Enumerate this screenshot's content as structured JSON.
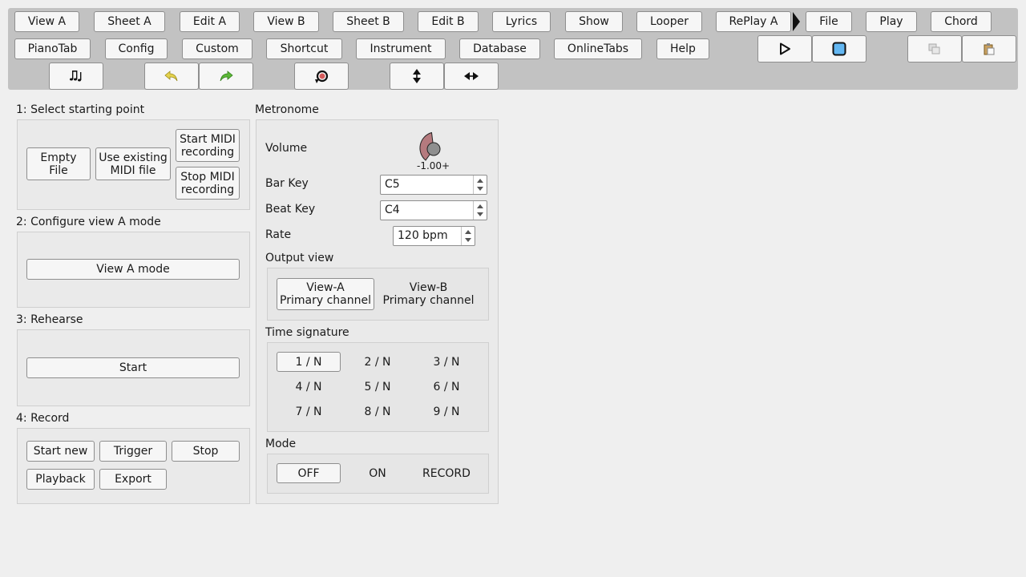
{
  "toolbar": {
    "row1": [
      "View A",
      "Sheet A",
      "Edit A",
      "View B",
      "Sheet B",
      "Edit B",
      "Lyrics",
      "Show",
      "Looper",
      "RePlay A",
      "File",
      "Play",
      "Chord"
    ],
    "row2": [
      "PianoTab",
      "Config",
      "Custom",
      "Shortcut",
      "Instrument",
      "Database",
      "OnlineTabs",
      "Help"
    ],
    "icons": {
      "play": "play-icon",
      "stop": "stop-icon",
      "copy": "copy-icon",
      "paste": "paste-icon",
      "notes": "music-notes-icon",
      "undo": "undo-icon",
      "redo": "redo-icon",
      "refresh": "refresh-icon",
      "vertical": "vertical-resize-icon",
      "horizontal": "horizontal-resize-icon"
    }
  },
  "step1": {
    "title": "1: Select starting point",
    "empty_file": "Empty\nFile",
    "use_existing": "Use existing\nMIDI file",
    "start_midi": "Start MIDI\nrecording",
    "stop_midi": "Stop MIDI\nrecording"
  },
  "step2": {
    "title": "2: Configure view A mode",
    "view_a_mode": "View A mode"
  },
  "step3": {
    "title": "3: Rehearse",
    "start": "Start"
  },
  "step4": {
    "title": "4: Record",
    "start_new": "Start new",
    "trigger": "Trigger",
    "stop": "Stop",
    "playback": "Playback",
    "export": "Export"
  },
  "metronome": {
    "title": "Metronome",
    "volume_label": "Volume",
    "volume_readout": "-1.00+",
    "bar_key_label": "Bar Key",
    "bar_key_value": "C5",
    "beat_key_label": "Beat Key",
    "beat_key_value": "C4",
    "rate_label": "Rate",
    "rate_value": "120 bpm",
    "output_view_title": "Output view",
    "output_view_a": "View-A\nPrimary channel",
    "output_view_b": "View-B\nPrimary channel",
    "time_signature_title": "Time signature",
    "time_signatures": [
      "1 / N",
      "2 / N",
      "3 / N",
      "4 / N",
      "5 / N",
      "6 / N",
      "7 / N",
      "8 / N",
      "9 / N"
    ],
    "mode_title": "Mode",
    "modes": [
      "OFF",
      "ON",
      "RECORD"
    ]
  },
  "colors": {
    "knob_fill": "#b57a7e",
    "stop_blue": "#63b7f2",
    "undo_yellow": "#e4d24d",
    "redo_green": "#5cb838"
  }
}
